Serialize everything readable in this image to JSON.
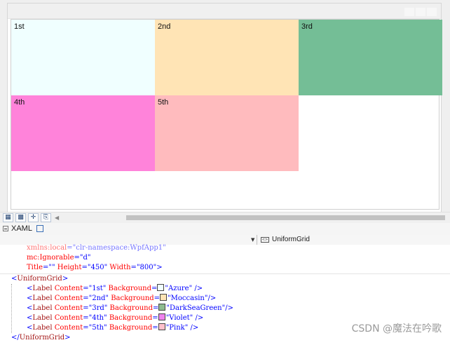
{
  "designer": {
    "cells": [
      {
        "label": "1st",
        "color": "#f0ffff"
      },
      {
        "label": "2nd",
        "color": "#ffe4b5"
      },
      {
        "label": "3rd",
        "color": "#74be96"
      },
      {
        "label": "4th",
        "color": "#ff83da"
      },
      {
        "label": "5th",
        "color": "#ffbbbe"
      }
    ]
  },
  "toolbar": {
    "icons": [
      "grid-icon",
      "checker-icon",
      "snap-icon",
      "code-icon"
    ]
  },
  "tabs": {
    "xaml_label": "XAML"
  },
  "nav": {
    "element_label": "UniformGrid"
  },
  "code": {
    "line_local": {
      "attr": "xmlns:local",
      "value": "\"clr-namespace:WpfApp1\""
    },
    "line_ignorable": {
      "attr": "mc:Ignorable",
      "value": "\"d\""
    },
    "line_title": {
      "t_attr": "Title",
      "t_val": "\"\"",
      "h_attr": "Height",
      "h_val": "\"450\"",
      "w_attr": "Width",
      "w_val": "\"800\"",
      "close": ">"
    },
    "open_tag": "UniformGrid",
    "labels": [
      {
        "tag": "Label",
        "c_attr": "Content",
        "c_val": "\"1st\"",
        "b_attr": "Background",
        "b_val": "\"Azure\"",
        "end": " />",
        "swatch": "#f0ffff"
      },
      {
        "tag": "Label",
        "c_attr": "Content",
        "c_val": "\"2nd\"",
        "b_attr": "Background",
        "b_val": "\"Moccasin\"",
        "end": "/>",
        "swatch": "#ffe4b5"
      },
      {
        "tag": "Label",
        "c_attr": "Content",
        "c_val": "\"3rd\"",
        "b_attr": "Background",
        "b_val": "\"DarkSeaGreen\"",
        "end": "/>",
        "swatch": "#8fbc8f"
      },
      {
        "tag": "Label",
        "c_attr": "Content",
        "c_val": "\"4th\"",
        "b_attr": "Background",
        "b_val": "\"Violet\"",
        "end": " />",
        "swatch": "#ee82ee"
      },
      {
        "tag": "Label",
        "c_attr": "Content",
        "c_val": "\"5th\"",
        "b_attr": "Background",
        "b_val": "\"Pink\"",
        "end": " />",
        "swatch": "#ffc0cb"
      }
    ],
    "close_tag": "UniformGrid"
  },
  "watermark": "CSDN @魔法在吟歌"
}
